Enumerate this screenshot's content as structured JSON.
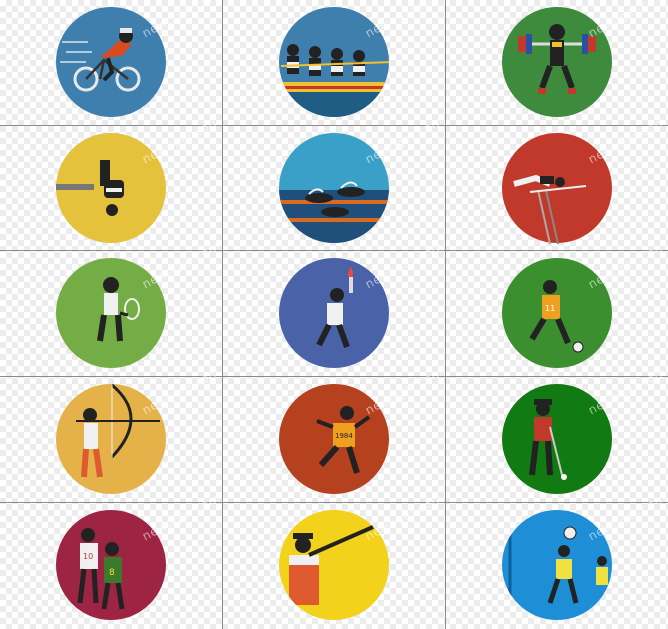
{
  "watermark": "newoger.com",
  "grid": {
    "columns": 3,
    "rows": 5,
    "line_color": "#8c8c8c"
  },
  "icons": [
    {
      "name": "cycling",
      "circle_color": "#3f7fae",
      "watermark": "newoger.com"
    },
    {
      "name": "rowing",
      "circle_color": "#3f7fae",
      "watermark": "newoger.com"
    },
    {
      "name": "weightlifting",
      "circle_color": "#3e8b3e",
      "watermark": "newoger.com"
    },
    {
      "name": "diving",
      "circle_color": "#e4c23c",
      "watermark": "newoger.com"
    },
    {
      "name": "swimming",
      "circle_color": "#3aa0c8",
      "watermark": "newoger.com"
    },
    {
      "name": "high-jump",
      "circle_color": "#c0392b",
      "watermark": "newoger.com"
    },
    {
      "name": "tennis",
      "circle_color": "#74ad45",
      "watermark": "newoger.com"
    },
    {
      "name": "torch-bearer",
      "circle_color": "#4a63a8",
      "watermark": "newoger.com"
    },
    {
      "name": "football",
      "circle_color": "#3c8f2e",
      "watermark": "newoger.com"
    },
    {
      "name": "archery",
      "circle_color": "#e5b24a",
      "watermark": "newoger.com"
    },
    {
      "name": "running",
      "circle_color": "#b5411f",
      "watermark": "newoger.com"
    },
    {
      "name": "golf",
      "circle_color": "#127a12",
      "watermark": "newoger.com"
    },
    {
      "name": "basketball",
      "circle_color": "#9e2444",
      "watermark": "newoger.com"
    },
    {
      "name": "shooting",
      "circle_color": "#f2d21a",
      "watermark": "newoger.com"
    },
    {
      "name": "volleyball",
      "circle_color": "#1e8fd6",
      "watermark": "newoger.com"
    }
  ],
  "jersey_numbers": {
    "football": "11",
    "running": "1984",
    "basketball_left": "10",
    "basketball_right": "8"
  }
}
